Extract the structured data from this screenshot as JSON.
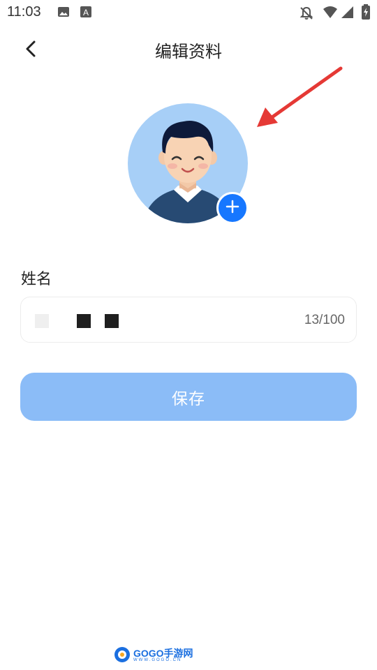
{
  "status_bar": {
    "time": "11:03",
    "icons": [
      "image-icon",
      "font-a-icon",
      "bell-off-icon",
      "wifi-icon",
      "signal-icon",
      "battery-charging-icon"
    ]
  },
  "header": {
    "title": "编辑资料",
    "back_icon": "chevron-left-icon"
  },
  "avatar": {
    "add_icon": "plus-icon",
    "accent": "#1677ff",
    "background": "#a7cff7"
  },
  "annotation": {
    "icon": "red-arrow-icon",
    "color": "#e53935"
  },
  "form": {
    "name_label": "姓名",
    "name_value_obscured": true,
    "counter": "13/100"
  },
  "save_button": {
    "label": "保存",
    "color": "#8bbcf7"
  },
  "watermark": {
    "text": "GOGO手游网",
    "sub": "WWW.GOGO.CN"
  }
}
